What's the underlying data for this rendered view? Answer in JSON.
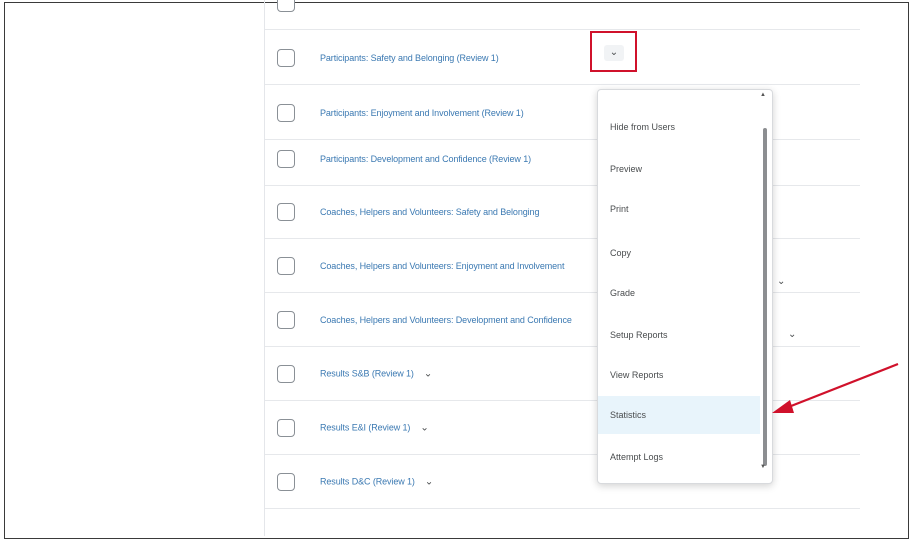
{
  "rows": [
    {
      "label": ""
    },
    {
      "label": "Participants: Safety and Belonging (Review 1)"
    },
    {
      "label": "Participants: Enjoyment and Involvement (Review 1)"
    },
    {
      "label": "Participants: Development and Confidence (Review 1)"
    },
    {
      "label": "Coaches, Helpers and Volunteers: Safety and Belonging"
    },
    {
      "label": "Coaches, Helpers and Volunteers: Enjoyment and Involvement"
    },
    {
      "label": "Coaches, Helpers and Volunteers: Development and Confidence"
    },
    {
      "label": "Results S&B (Review 1)"
    },
    {
      "label": "Results E&I (Review 1)"
    },
    {
      "label": "Results D&C (Review 1)"
    }
  ],
  "context_menu": {
    "items": [
      {
        "label": "Hide from Users"
      },
      {
        "label": "Preview"
      },
      {
        "label": "Print"
      },
      {
        "label": "Copy"
      },
      {
        "label": "Grade"
      },
      {
        "label": "Setup Reports"
      },
      {
        "label": "View Reports"
      },
      {
        "label": "Statistics"
      },
      {
        "label": "Attempt Logs"
      }
    ],
    "highlighted": "Statistics"
  },
  "icons": {
    "chevron": "chevron-down-icon",
    "annotation": "red-arrow"
  },
  "colors": {
    "link": "#3b79b2",
    "highlight_box": "#d0112b",
    "menu_highlight": "#e8f4fb",
    "annotation_arrow": "#d0112b"
  }
}
